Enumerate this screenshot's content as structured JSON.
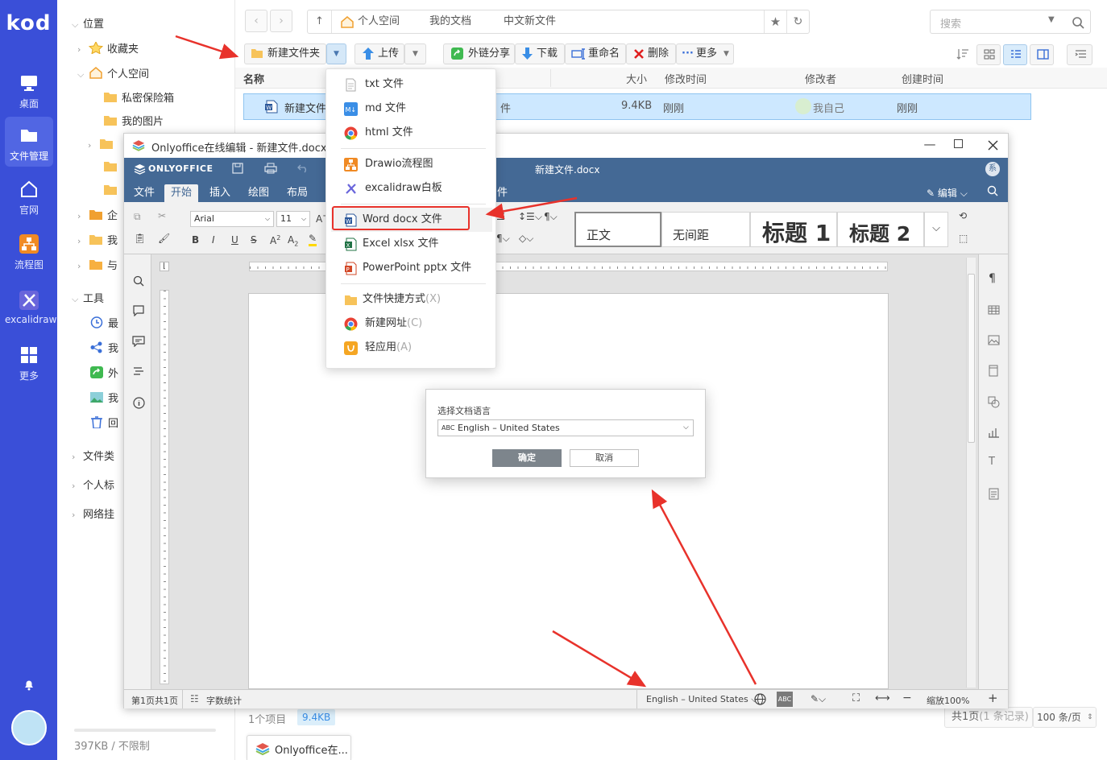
{
  "rail": {
    "logo": "kod",
    "items": [
      {
        "label": "桌面",
        "icon": "desktop-icon"
      },
      {
        "label": "文件管理",
        "icon": "folder-icon",
        "active": true
      },
      {
        "label": "官网",
        "icon": "home-icon"
      },
      {
        "label": "流程图",
        "icon": "flowchart-icon"
      },
      {
        "label": "excalidraw",
        "icon": "excalidraw-icon"
      },
      {
        "label": "更多",
        "icon": "grid-icon"
      }
    ]
  },
  "tree": {
    "location": "位置",
    "favorites": "收藏夹",
    "personal": "个人空间",
    "private_vault": "私密保险箱",
    "my_pictures": "我的图片",
    "enterprise": "企",
    "mine": "我",
    "shared": "与",
    "tools": "工具",
    "recent": "最",
    "my_share": "我",
    "external": "外",
    "my_photo": "我",
    "recycle": "回",
    "file_types": "文件类",
    "personal_tags": "个人标",
    "network_mount": "网络挂",
    "storage": "397KB / 不限制"
  },
  "breadcrumb": [
    "个人空间",
    "我的文档",
    "中文新文件"
  ],
  "search_placeholder": "搜索",
  "toolbar": {
    "new_folder": "新建文件夹",
    "upload": "上传",
    "share_link": "外链分享",
    "download": "下载",
    "rename": "重命名",
    "delete": "删除",
    "more": "更多"
  },
  "columns": {
    "name": "名称",
    "size": "大小",
    "modified": "修改时间",
    "modifier": "修改者",
    "created": "创建时间"
  },
  "file_row": {
    "name": "新建文件",
    "type_suffix": "件",
    "size": "9.4KB",
    "modified": "刚刚",
    "modifier": "我自己",
    "created": "刚刚"
  },
  "new_menu": {
    "items": [
      {
        "label": "txt 文件"
      },
      {
        "label": "md 文件"
      },
      {
        "label": "html 文件"
      },
      {
        "label": "Drawio流程图"
      },
      {
        "label": "excalidraw白板"
      },
      {
        "label": "Word docx 文件"
      },
      {
        "label": "Excel xlsx 文件"
      },
      {
        "label": "PowerPoint pptx 文件"
      },
      {
        "label": "文件快捷方式",
        "shortcut": "(X)"
      },
      {
        "label": "新建网址",
        "shortcut": "(C)"
      },
      {
        "label": "轻应用",
        "shortcut": "(A)"
      }
    ]
  },
  "onlyoffice": {
    "window_title": "Onlyoffice在线编辑 - 新建文件.docx",
    "brand": "ONLYOFFICE",
    "doc_title": "新建文件.docx",
    "avatar_letter": "系",
    "edit_label": "编辑",
    "tabs": [
      "文件",
      "开始",
      "插入",
      "绘图",
      "布局"
    ],
    "tab_cut": "件",
    "font_name": "Arial",
    "font_size": "11",
    "styles": [
      "正文",
      "无间距",
      "标题 1",
      "标题 2"
    ],
    "status": {
      "page": "第1页共1页",
      "word_count": "字数统计",
      "language": "English – United States",
      "zoom": "缩放100%"
    },
    "dialog": {
      "title": "选择文档语言",
      "value": "English – United States",
      "ok": "确定",
      "cancel": "取消"
    }
  },
  "footer": {
    "count": "1个项目",
    "size_badge": "9.4KB",
    "pages": "共1页",
    "records": "(1 条记录)",
    "per_page": "100 条/页"
  },
  "taskbar": {
    "item": "Onlyoffice在..."
  },
  "colors": {
    "rail": "#3a4fd8",
    "oo_header": "#446995",
    "selection": "#cde8ff",
    "annotation": "#e8322b"
  }
}
